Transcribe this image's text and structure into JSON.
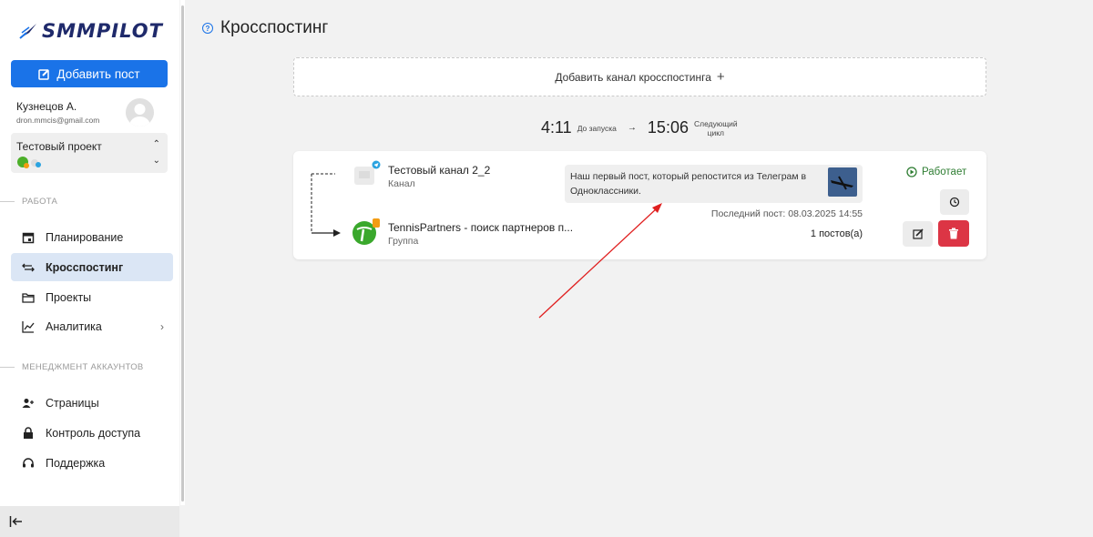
{
  "sidebar": {
    "logo_text": "SMMPILOT",
    "add_post_label": "Добавить пост",
    "user_name": "Кузнецов А.",
    "user_email": "dron.mmcis@gmail.com",
    "project_name": "Тестовый проект",
    "section_work": "РАБОТА",
    "section_accounts": "МЕНЕДЖМЕНТ АККАУНТОВ",
    "nav": [
      {
        "label": "Планирование",
        "icon": "calendar-icon"
      },
      {
        "label": "Кросспостинг",
        "icon": "crosspost-icon",
        "active": true
      },
      {
        "label": "Проекты",
        "icon": "folder-icon"
      },
      {
        "label": "Аналитика",
        "icon": "chart-icon"
      },
      {
        "label": "Страницы",
        "icon": "add-user-icon"
      },
      {
        "label": "Контроль доступа",
        "icon": "lock-icon"
      },
      {
        "label": "Поддержка",
        "icon": "headset-icon"
      }
    ]
  },
  "main": {
    "title": "Кросспостинг",
    "add_channel_label": "Добавить канал кросспостинга",
    "timer": {
      "until_start_value": "4:11",
      "until_start_label": "До запуска",
      "next_cycle_value": "15:06",
      "next_cycle_label_1": "Следующий",
      "next_cycle_label_2": "цикл"
    },
    "card": {
      "source_name": "Тестовый канал 2_2",
      "source_type": "Канал",
      "target_name": "TennisPartners - поиск партнеров п...",
      "target_type": "Группа",
      "post_text": "Наш первый пост, который репостится из Телеграм в Одноклассники.",
      "last_post": "Последний пост: 08.03.2025 14:55",
      "post_count": "1 постов(а)",
      "status": "Работает"
    }
  },
  "colors": {
    "primary": "#1a73e8",
    "active_nav_bg": "#dbe6f5",
    "status_green": "#2e7d32",
    "delete_red": "#dc3545",
    "annotation_arrow": "#e02020"
  }
}
